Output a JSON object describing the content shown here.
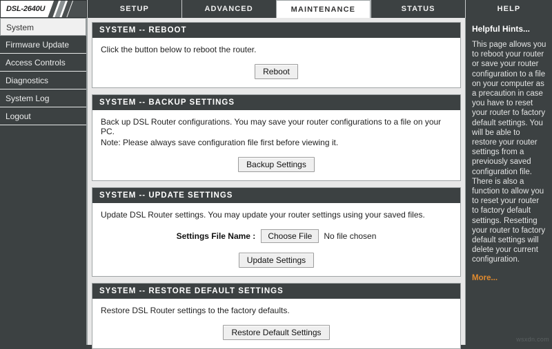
{
  "brand": {
    "model": "DSL-2640U"
  },
  "tabs": [
    {
      "label": "SETUP",
      "active": false
    },
    {
      "label": "ADVANCED",
      "active": false
    },
    {
      "label": "MAINTENANCE",
      "active": true
    },
    {
      "label": "STATUS",
      "active": false
    },
    {
      "label": "HELP",
      "active": false
    }
  ],
  "sidebar": {
    "items": [
      {
        "label": "System",
        "active": true
      },
      {
        "label": "Firmware Update",
        "active": false
      },
      {
        "label": "Access Controls",
        "active": false
      },
      {
        "label": "Diagnostics",
        "active": false
      },
      {
        "label": "System Log",
        "active": false
      },
      {
        "label": "Logout",
        "active": false
      }
    ]
  },
  "panels": {
    "reboot": {
      "title": "SYSTEM -- REBOOT",
      "description": "Click the button below to reboot the router.",
      "button": "Reboot"
    },
    "backup": {
      "title": "SYSTEM -- BACKUP SETTINGS",
      "description": "Back up DSL Router configurations. You may save your router configurations to a file on your PC.",
      "note": "Note: Please always save configuration file first before viewing it.",
      "button": "Backup Settings"
    },
    "update": {
      "title": "SYSTEM -- UPDATE SETTINGS",
      "description": "Update DSL Router settings. You may update your router settings using your saved files.",
      "field_label": "Settings File Name :",
      "file_button": "Choose File",
      "file_status": "No file chosen",
      "button": "Update Settings"
    },
    "restore": {
      "title": "SYSTEM -- RESTORE DEFAULT SETTINGS",
      "description": "Restore DSL Router settings to the factory defaults.",
      "button": "Restore Default Settings"
    }
  },
  "hints": {
    "title": "Helpful Hints...",
    "text": "This page allows you to reboot your router or save your router configuration to a file on your computer as a precaution in case you have to reset your router to factory default settings. You will be able to restore your router settings from a previously saved configuration file. There is also a function to allow you to reset your router to factory default settings. Resetting your router to factory default settings will delete your current configuration.",
    "more": "More..."
  },
  "watermark": "wsxdn.com",
  "colors": {
    "dark": "#3c4142",
    "accent_orange": "#e08a2e",
    "note_red": "#e02020",
    "panel_bg": "#ffffff",
    "page_bg": "#e8e8e8"
  }
}
